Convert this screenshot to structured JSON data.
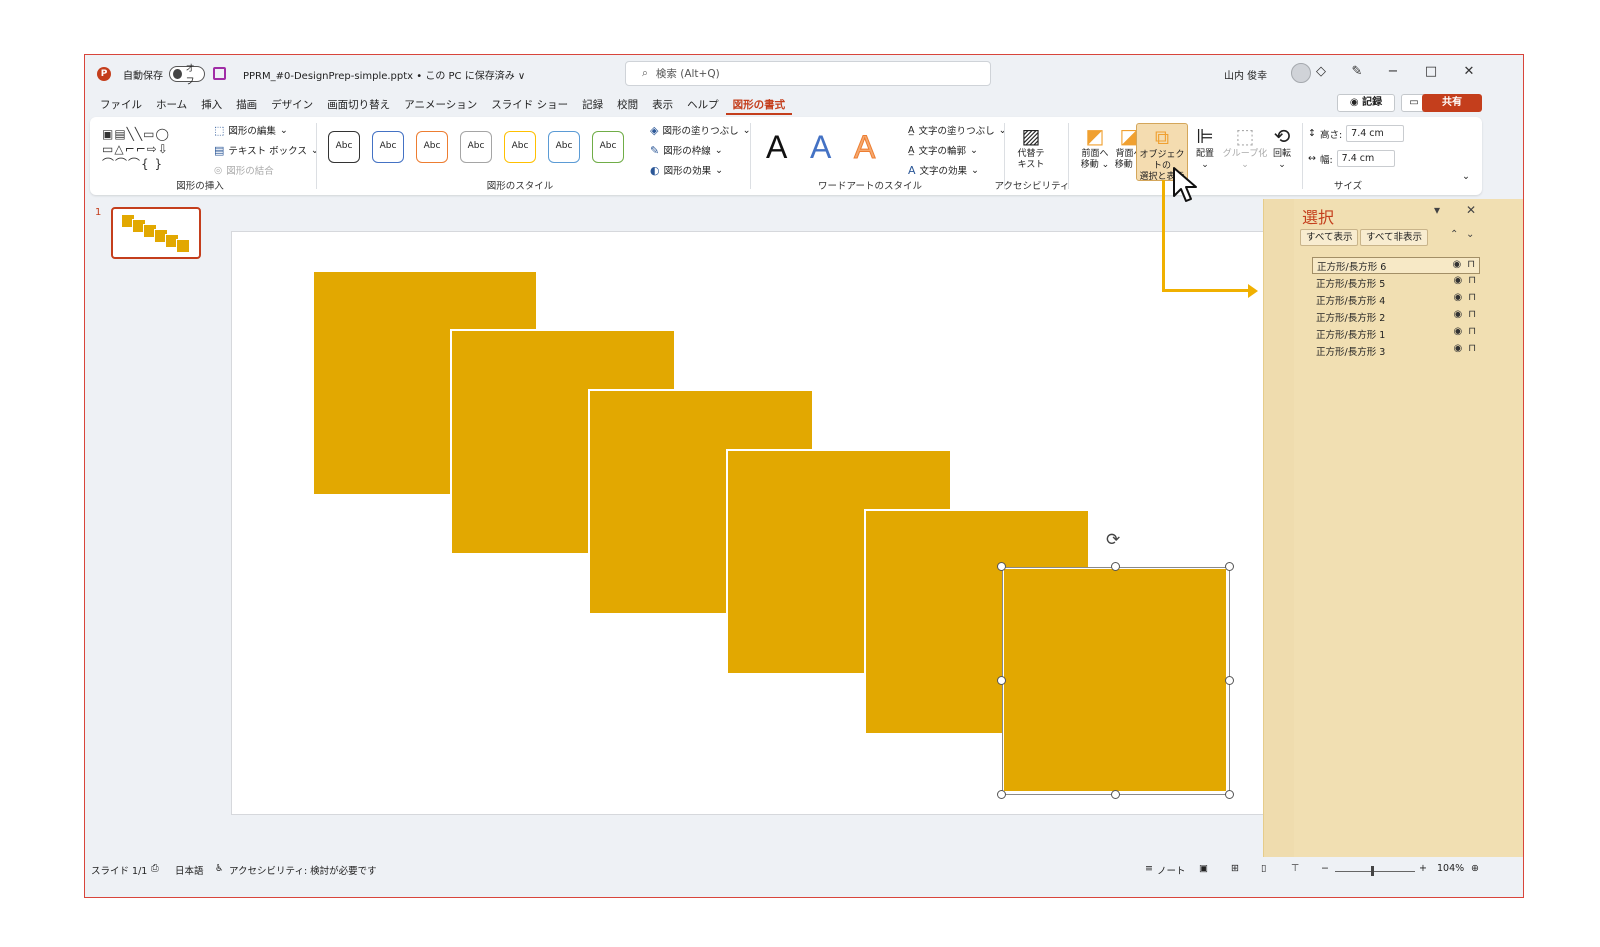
{
  "titlebar": {
    "autosave_label": "自動保存",
    "autosave_state": "オフ",
    "filename": "PPRM_#0-DesignPrep-simple.pptx • この PC に保存済み ∨",
    "search_placeholder": "検索 (Alt+Q)",
    "user_name": "山内 俊幸"
  },
  "tabs": [
    "ファイル",
    "ホーム",
    "挿入",
    "描画",
    "デザイン",
    "画面切り替え",
    "アニメーション",
    "スライド ショー",
    "記録",
    "校閲",
    "表示",
    "ヘルプ",
    "図形の書式"
  ],
  "header_buttons": {
    "record": "◉ 記録",
    "comment": "▭",
    "share": "共有"
  },
  "ribbon": {
    "insert_shapes": {
      "edit_shape": "図形の編集",
      "text_box": "テキスト ボックス",
      "merge_shapes": "図形の結合",
      "label": "図形の挿入"
    },
    "shape_styles": {
      "preset_label": "Abc",
      "preset_colors": [
        "#333333",
        "#4472c4",
        "#ed7d31",
        "#a5a5a5",
        "#ffc000",
        "#5b9bd5",
        "#70ad47"
      ],
      "fill": "図形の塗りつぶし",
      "outline": "図形の枠線",
      "effects": "図形の効果",
      "label": "図形のスタイル"
    },
    "wordart": {
      "letter": "A",
      "text_fill": "文字の塗りつぶし",
      "text_outline": "文字の輪郭",
      "text_effects": "文字の効果",
      "label": "ワードアートのスタイル"
    },
    "accessibility": {
      "alt_text_1": "代替テ",
      "alt_text_2": "キスト",
      "label": "アクセシビリティ"
    },
    "arrange": {
      "bring_forward_1": "前面へ",
      "bring_forward_2": "移動 ⌄",
      "send_backward_1": "背面へ",
      "send_backward_2": "移動 ⌄",
      "selection_pane_1": "オブジェクトの",
      "selection_pane_2": "選択と表示",
      "align": "配置",
      "group": "グループ化",
      "rotate": "回転"
    },
    "size": {
      "height_label": "高さ:",
      "height_value": "7.4 cm",
      "width_label": "幅:",
      "width_value": "7.4 cm",
      "label": "サイズ"
    }
  },
  "slides": {
    "current_number": "1"
  },
  "selection_pane": {
    "title": "選択",
    "show_all": "すべて表示",
    "hide_all": "すべて非表示",
    "items": [
      "正方形/長方形 6",
      "正方形/長方形 5",
      "正方形/長方形 4",
      "正方形/長方形 2",
      "正方形/長方形 1",
      "正方形/長方形 3"
    ]
  },
  "status": {
    "slide": "スライド 1/1",
    "language": "日本語",
    "accessibility": "アクセシビリティ: 検討が必要です",
    "notes": "ノート",
    "zoom": "104%"
  },
  "colors": {
    "accent": "#c43e1c",
    "shape_fill": "#e2a801",
    "pane_bg": "#efdcae",
    "annotation": "#f0b000"
  }
}
